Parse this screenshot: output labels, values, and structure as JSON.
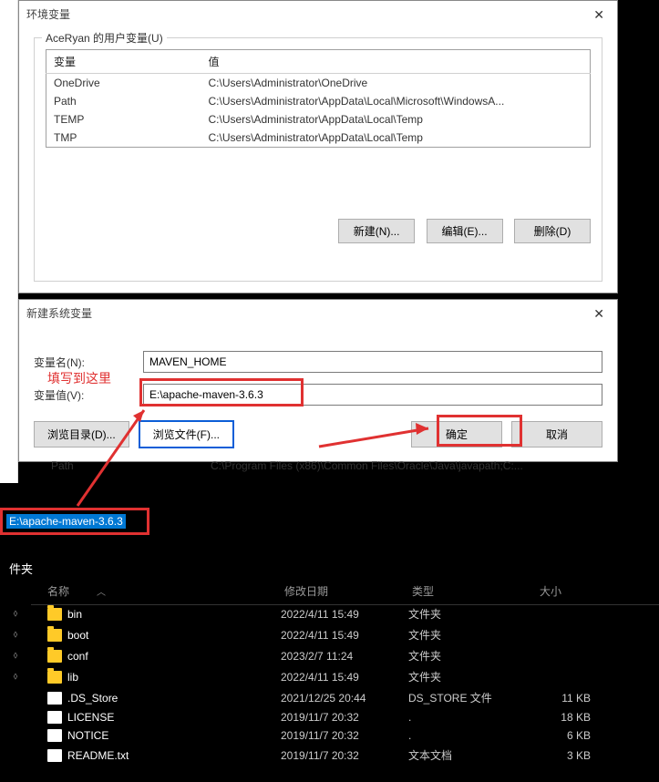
{
  "env_dialog": {
    "title": "环境变量",
    "user_vars_label": "AceRyan 的用户变量(U)",
    "columns": {
      "name": "变量",
      "value": "值"
    },
    "rows": [
      {
        "name": "OneDrive",
        "value": "C:\\Users\\Administrator\\OneDrive"
      },
      {
        "name": "Path",
        "value": "C:\\Users\\Administrator\\AppData\\Local\\Microsoft\\WindowsA..."
      },
      {
        "name": "TEMP",
        "value": "C:\\Users\\Administrator\\AppData\\Local\\Temp"
      },
      {
        "name": "TMP",
        "value": "C:\\Users\\Administrator\\AppData\\Local\\Temp"
      }
    ],
    "buttons": {
      "new": "新建(N)...",
      "edit": "编辑(E)...",
      "delete": "删除(D)"
    }
  },
  "new_var_dialog": {
    "title": "新建系统变量",
    "name_label": "变量名(N):",
    "name_value": "MAVEN_HOME",
    "value_label": "变量值(V):",
    "value_value": "E:\\apache-maven-3.6.3",
    "browse_dir": "浏览目录(D)...",
    "browse_file": "浏览文件(F)...",
    "ok": "确定",
    "cancel": "取消"
  },
  "annotation": {
    "text": "填写到这里"
  },
  "truncated": {
    "label": "Path",
    "value": "C:\\Program Files (x86)\\Common Files\\Oracle\\Java\\javapath;C:..."
  },
  "address_bar": "E:\\apache-maven-3.6.3",
  "explorer": {
    "section": "件夹",
    "columns": {
      "name": "名称",
      "date": "修改日期",
      "type": "类型",
      "size": "大小"
    },
    "rows": [
      {
        "pin": true,
        "icon": "folder",
        "name": "bin",
        "date": "2022/4/11 15:49",
        "type": "文件夹",
        "size": ""
      },
      {
        "pin": true,
        "icon": "folder",
        "name": "boot",
        "date": "2022/4/11 15:49",
        "type": "文件夹",
        "size": ""
      },
      {
        "pin": true,
        "icon": "folder",
        "name": "conf",
        "date": "2023/2/7 11:24",
        "type": "文件夹",
        "size": ""
      },
      {
        "pin": true,
        "icon": "folder",
        "name": "lib",
        "date": "2022/4/11 15:49",
        "type": "文件夹",
        "size": ""
      },
      {
        "pin": false,
        "icon": "file",
        "name": ".DS_Store",
        "date": "2021/12/25 20:44",
        "type": "DS_STORE 文件",
        "size": "11 KB"
      },
      {
        "pin": false,
        "icon": "file",
        "name": "LICENSE",
        "date": "2019/11/7 20:32",
        "type": ".",
        "size": "18 KB"
      },
      {
        "pin": false,
        "icon": "file",
        "name": "NOTICE",
        "date": "2019/11/7 20:32",
        "type": ".",
        "size": "6 KB"
      },
      {
        "pin": false,
        "icon": "file",
        "name": "README.txt",
        "date": "2019/11/7 20:32",
        "type": "文本文档",
        "size": "3 KB"
      }
    ]
  }
}
